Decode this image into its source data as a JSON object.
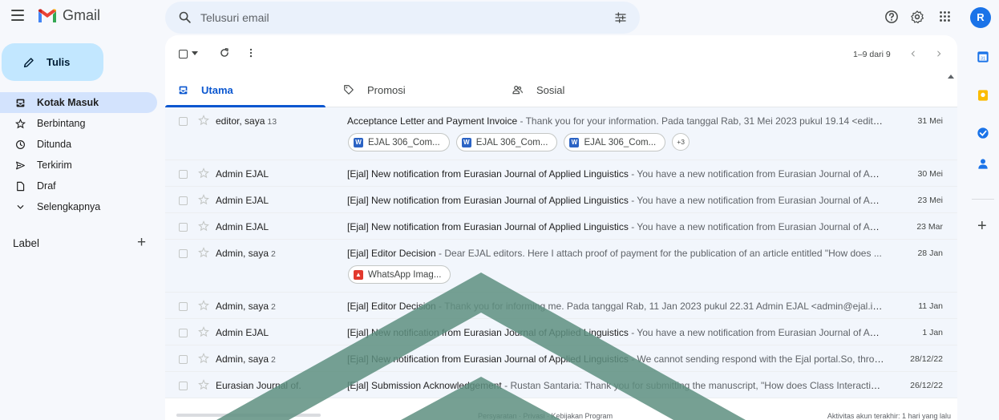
{
  "app": {
    "title": "Gmail",
    "avatar_initial": "R"
  },
  "search": {
    "placeholder": "Telusuri email"
  },
  "sidebar": {
    "compose_label": "Tulis",
    "items": [
      {
        "label": "Kotak Masuk",
        "icon": "inbox-icon",
        "active": true
      },
      {
        "label": "Berbintang",
        "icon": "star-icon"
      },
      {
        "label": "Ditunda",
        "icon": "clock-icon"
      },
      {
        "label": "Terkirim",
        "icon": "send-icon"
      },
      {
        "label": "Draf",
        "icon": "draft-icon"
      },
      {
        "label": "Selengkapnya",
        "icon": "chevron-down-icon"
      }
    ],
    "labels_heading": "Label"
  },
  "toolbar": {
    "pagination": "1–9 dari 9"
  },
  "tabs": [
    {
      "label": "Utama",
      "icon": "inbox-icon",
      "active": true
    },
    {
      "label": "Promosi",
      "icon": "tag-icon"
    },
    {
      "label": "Sosial",
      "icon": "people-icon"
    }
  ],
  "emails": [
    {
      "sender": "editor, saya",
      "count": "13",
      "subject": "Acceptance Letter and Payment Invoice",
      "snippet": " - Thank you for your information. Pada tanggal Rab, 31 Mei 2023 pukul 19.14 <editor@...",
      "date": "31 Mei",
      "attachments": [
        "EJAL 306_Com...",
        "EJAL 306_Com...",
        "EJAL 306_Com..."
      ],
      "more_attachments": "+3"
    },
    {
      "sender": "Admin EJAL",
      "count": "",
      "subject": "[Ejal] New notification from Eurasian Journal of Applied Linguistics",
      "snippet": " - You have a new notification from Eurasian Journal of App...",
      "date": "30 Mei"
    },
    {
      "sender": "Admin EJAL",
      "count": "",
      "subject": "[Ejal] New notification from Eurasian Journal of Applied Linguistics",
      "snippet": " - You have a new notification from Eurasian Journal of App...",
      "date": "23 Mei"
    },
    {
      "sender": "Admin EJAL",
      "count": "",
      "subject": "[Ejal] New notification from Eurasian Journal of Applied Linguistics",
      "snippet": " - You have a new notification from Eurasian Journal of App...",
      "date": "23 Mar"
    },
    {
      "sender": "Admin, saya",
      "count": "2",
      "subject": "[Ejal] Editor Decision",
      "snippet": " - Dear EJAL editors. Here I attach proof of payment for the publication of an article entitled \"How does ...",
      "date": "28 Jan",
      "attachments": [
        "WhatsApp Imag..."
      ]
    },
    {
      "sender": "Admin, saya",
      "count": "2",
      "subject": "[Ejal] Editor Decision",
      "snippet": " - Thank you for informing me. Pada tanggal Rab, 11 Jan 2023 pukul 22.31 Admin EJAL <admin@ejal.info> ...",
      "date": "11 Jan"
    },
    {
      "sender": "Admin EJAL",
      "count": "",
      "subject": "[Ejal] New notification from Eurasian Journal of Applied Linguistics",
      "snippet": " - You have a new notification from Eurasian Journal of App...",
      "date": "1 Jan"
    },
    {
      "sender": "Admin, saya",
      "count": "2",
      "subject": "[Ejal] New notification from Eurasian Journal of Applied Linguistics",
      "snippet": " - We cannot sending respond with the Ejal portal.So, throu...",
      "date": "28/12/22"
    },
    {
      "sender": "Eurasian Journal of.",
      "count": "",
      "subject": "[Ejal] Submission Acknowledgement",
      "snippet": " - Rustan Santaria: Thank you for submitting the manuscript, \"How does Class Interaction ...",
      "date": "26/12/22"
    }
  ],
  "footer": {
    "links": "Persyaratan · Privasi · Kebijakan Program",
    "activity": "Aktivitas akun terakhir: 1 hari yang lalu",
    "storage_used_fraction": 0.0
  },
  "colors": {
    "accent": "#0b57d0",
    "compose_bg": "#c2e7ff",
    "active_nav": "#d3e3fd",
    "watermark": "#5e8f80"
  }
}
